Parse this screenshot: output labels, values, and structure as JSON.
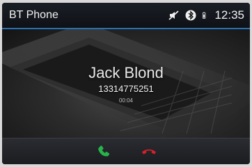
{
  "status_bar": {
    "title": "BT Phone",
    "icons": [
      "mute-icon",
      "bluetooth-icon",
      "phone-battery-icon"
    ],
    "time": "12:35"
  },
  "call": {
    "caller_name": "Jack Blond",
    "caller_number": "13314775251",
    "duration": "00:04"
  },
  "controls": {
    "answer_icon": "answer-call-icon",
    "hangup_icon": "hang-up-icon"
  },
  "colors": {
    "accent": "#2a6fb0",
    "answer": "#27b34a",
    "hangup": "#d8202a"
  }
}
